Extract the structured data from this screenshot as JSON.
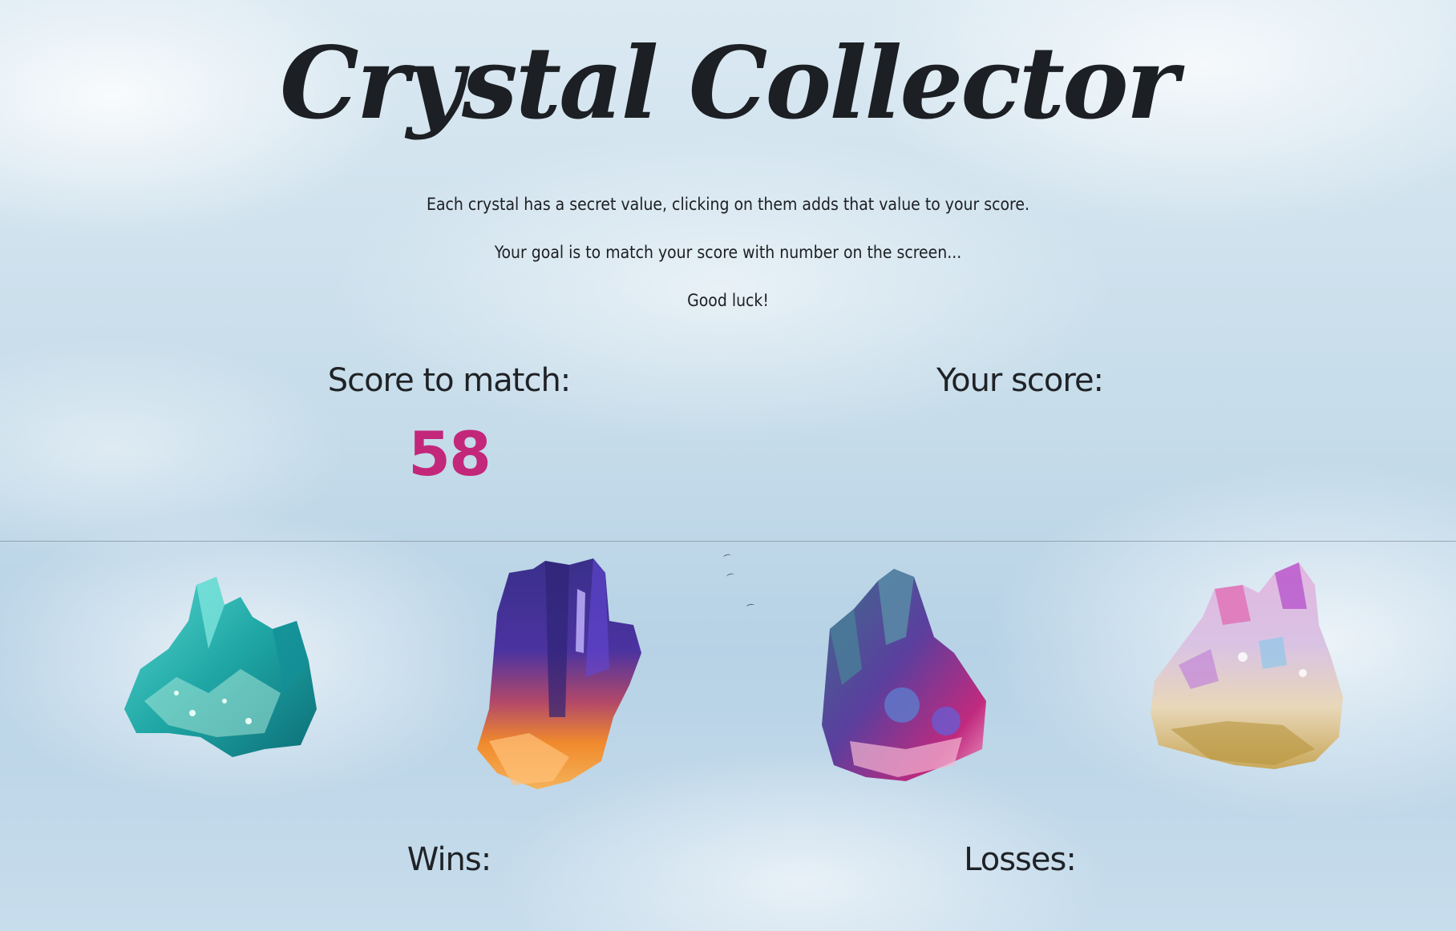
{
  "title": "Crystal Collector",
  "intro": {
    "line1": "Each crystal has a secret value, clicking on them adds that value to your score.",
    "line2": "Your goal is to match your score with number on the screen...",
    "line3": "Good luck!"
  },
  "scores": {
    "target_label": "Score to match:",
    "target_value": "58",
    "user_label": "Your score:",
    "user_value": ""
  },
  "crystals": [
    {
      "name": "teal-crystal",
      "color": "#2fb8b0"
    },
    {
      "name": "purple-orange-crystal",
      "color": "#5a3fa8"
    },
    {
      "name": "purple-pink-crystal",
      "color": "#6a4fb8"
    },
    {
      "name": "rainbow-aura-crystal",
      "color": "#d8b7d8"
    }
  ],
  "tally": {
    "wins_label": "Wins:",
    "wins_value": "",
    "losses_label": "Losses:",
    "losses_value": ""
  },
  "colors": {
    "accent": "#c3277a",
    "text": "#1f2226",
    "sky": "#c6dcea"
  }
}
